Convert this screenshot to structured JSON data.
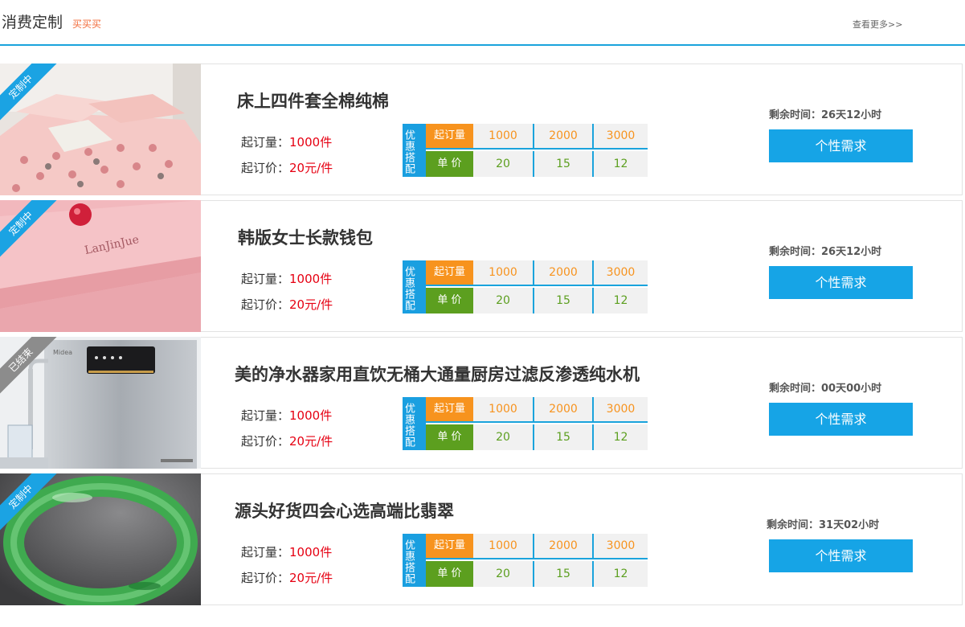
{
  "header": {
    "title": "消费定制",
    "subtitle": "买买买",
    "more_link": "查看更多>>"
  },
  "colors": {
    "accent": "#1aa3dc",
    "orange": "#f7931e",
    "green": "#5c9f1f",
    "red": "#e60012",
    "button": "#16a4e6"
  },
  "items": [
    {
      "status": "定制中",
      "name": "床上四件套全棉纯棉",
      "moq_label": "起订量：",
      "moq_value": "1000件",
      "mop_label": "起订价：",
      "mop_value": "20元/件",
      "badge": "优惠搭配",
      "row1_label": "起订量",
      "row2_label": "单  价",
      "qtys": [
        "1000",
        "2000",
        "3000"
      ],
      "prices": [
        "20",
        "15",
        "12"
      ],
      "time_left": "剩余时间：26天12小时",
      "button": "个性需求",
      "image": "pink-bedding"
    },
    {
      "status": "定制中",
      "name": "韩版女士长款钱包",
      "moq_label": "起订量：",
      "moq_value": "1000件",
      "mop_label": "起订价：",
      "mop_value": "20元/件",
      "badge": "优惠搭配",
      "row1_label": "起订量",
      "row2_label": "单  价",
      "qtys": [
        "1000",
        "2000",
        "3000"
      ],
      "prices": [
        "20",
        "15",
        "12"
      ],
      "time_left": "剩余时间：26天12小时",
      "button": "个性需求",
      "image": "pink-wallet",
      "image_text": "LanJinJue"
    },
    {
      "status": "已结束",
      "name": "美的净水器家用直饮无桶大通量厨房过滤反渗透纯水机",
      "moq_label": "起订量：",
      "moq_value": "1000件",
      "mop_label": "起订价：",
      "mop_value": "20元/件",
      "badge": "优惠搭配",
      "row1_label": "起订量",
      "row2_label": "单  价",
      "qtys": [
        "1000",
        "2000",
        "3000"
      ],
      "prices": [
        "20",
        "15",
        "12"
      ],
      "time_left": "剩余时间：00天00小时",
      "button": "个性需求",
      "image": "water-purifier",
      "image_text": "Midea"
    },
    {
      "status": "定制中",
      "name": "源头好货四会心选高端比翡翠",
      "moq_label": "起订量：",
      "moq_value": "1000件",
      "mop_label": "起订价：",
      "mop_value": "20元/件",
      "badge": "优惠搭配",
      "row1_label": "起订量",
      "row2_label": "单  价",
      "qtys": [
        "1000",
        "2000",
        "3000"
      ],
      "prices": [
        "20",
        "15",
        "12"
      ],
      "time_left": "剩余时间：31天02小时",
      "button": "个性需求",
      "image": "jade-bangle"
    }
  ]
}
